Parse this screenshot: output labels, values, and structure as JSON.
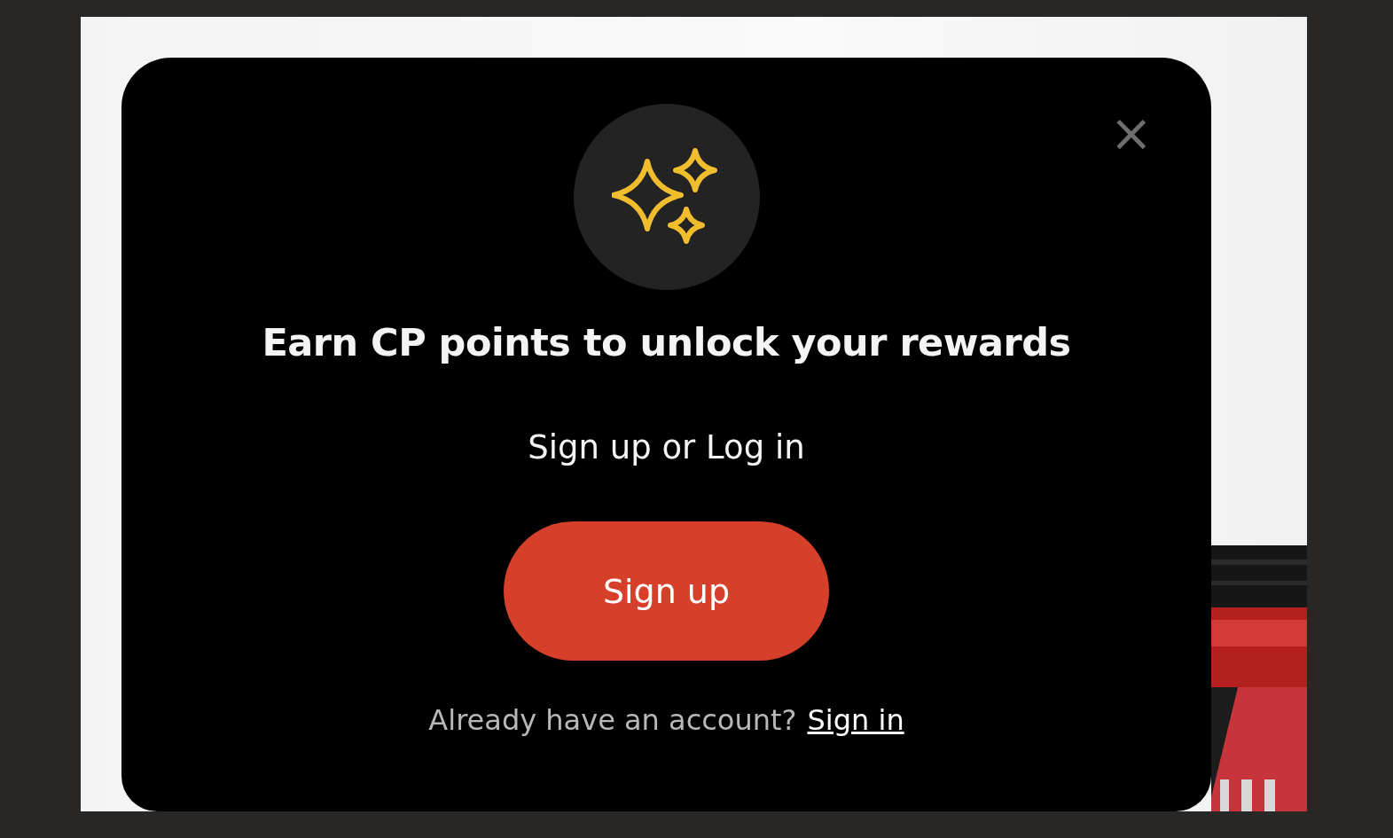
{
  "dialog": {
    "title": "Earn CP points to unlock your rewards",
    "subtitle": "Sign up or Log in",
    "primary_button": "Sign up",
    "footer": {
      "text": "Already have an account?",
      "link": "Sign in"
    },
    "close": "×"
  }
}
